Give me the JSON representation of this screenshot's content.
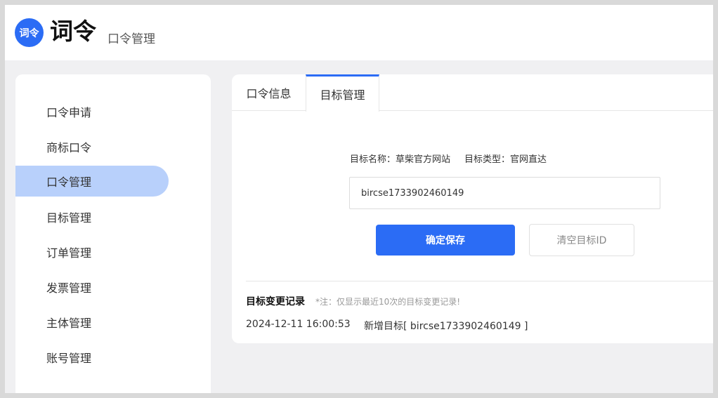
{
  "header": {
    "logo_badge": "词令",
    "brand": "词令",
    "subtitle": "口令管理"
  },
  "sidebar": {
    "items": [
      {
        "label": "口令申请"
      },
      {
        "label": "商标口令"
      },
      {
        "label": "口令管理",
        "active": true
      },
      {
        "label": "目标管理"
      },
      {
        "label": "订单管理"
      },
      {
        "label": "发票管理"
      },
      {
        "label": "主体管理"
      },
      {
        "label": "账号管理"
      }
    ]
  },
  "tabs": [
    {
      "label": "口令信息"
    },
    {
      "label": "目标管理",
      "active": true
    }
  ],
  "target": {
    "name_label": "目标名称：",
    "name_value": "草柴官方网站",
    "type_label": "目标类型：",
    "type_value": "官网直达",
    "input_value": "bircse1733902460149"
  },
  "buttons": {
    "confirm_label": "确定保存",
    "clear_label": "清空目标ID"
  },
  "history": {
    "title": "目标变更记录",
    "note": "*注：仅显示最近10次的目标变更记录!",
    "records": [
      {
        "time": "2024-12-11 16:00:53",
        "desc": "新增目标[ bircse1733902460149 ]"
      }
    ]
  },
  "colors": {
    "accent": "#2b6cf5",
    "active_nav_bg": "#b8d0fb",
    "page_bg": "#f0f0f2"
  }
}
